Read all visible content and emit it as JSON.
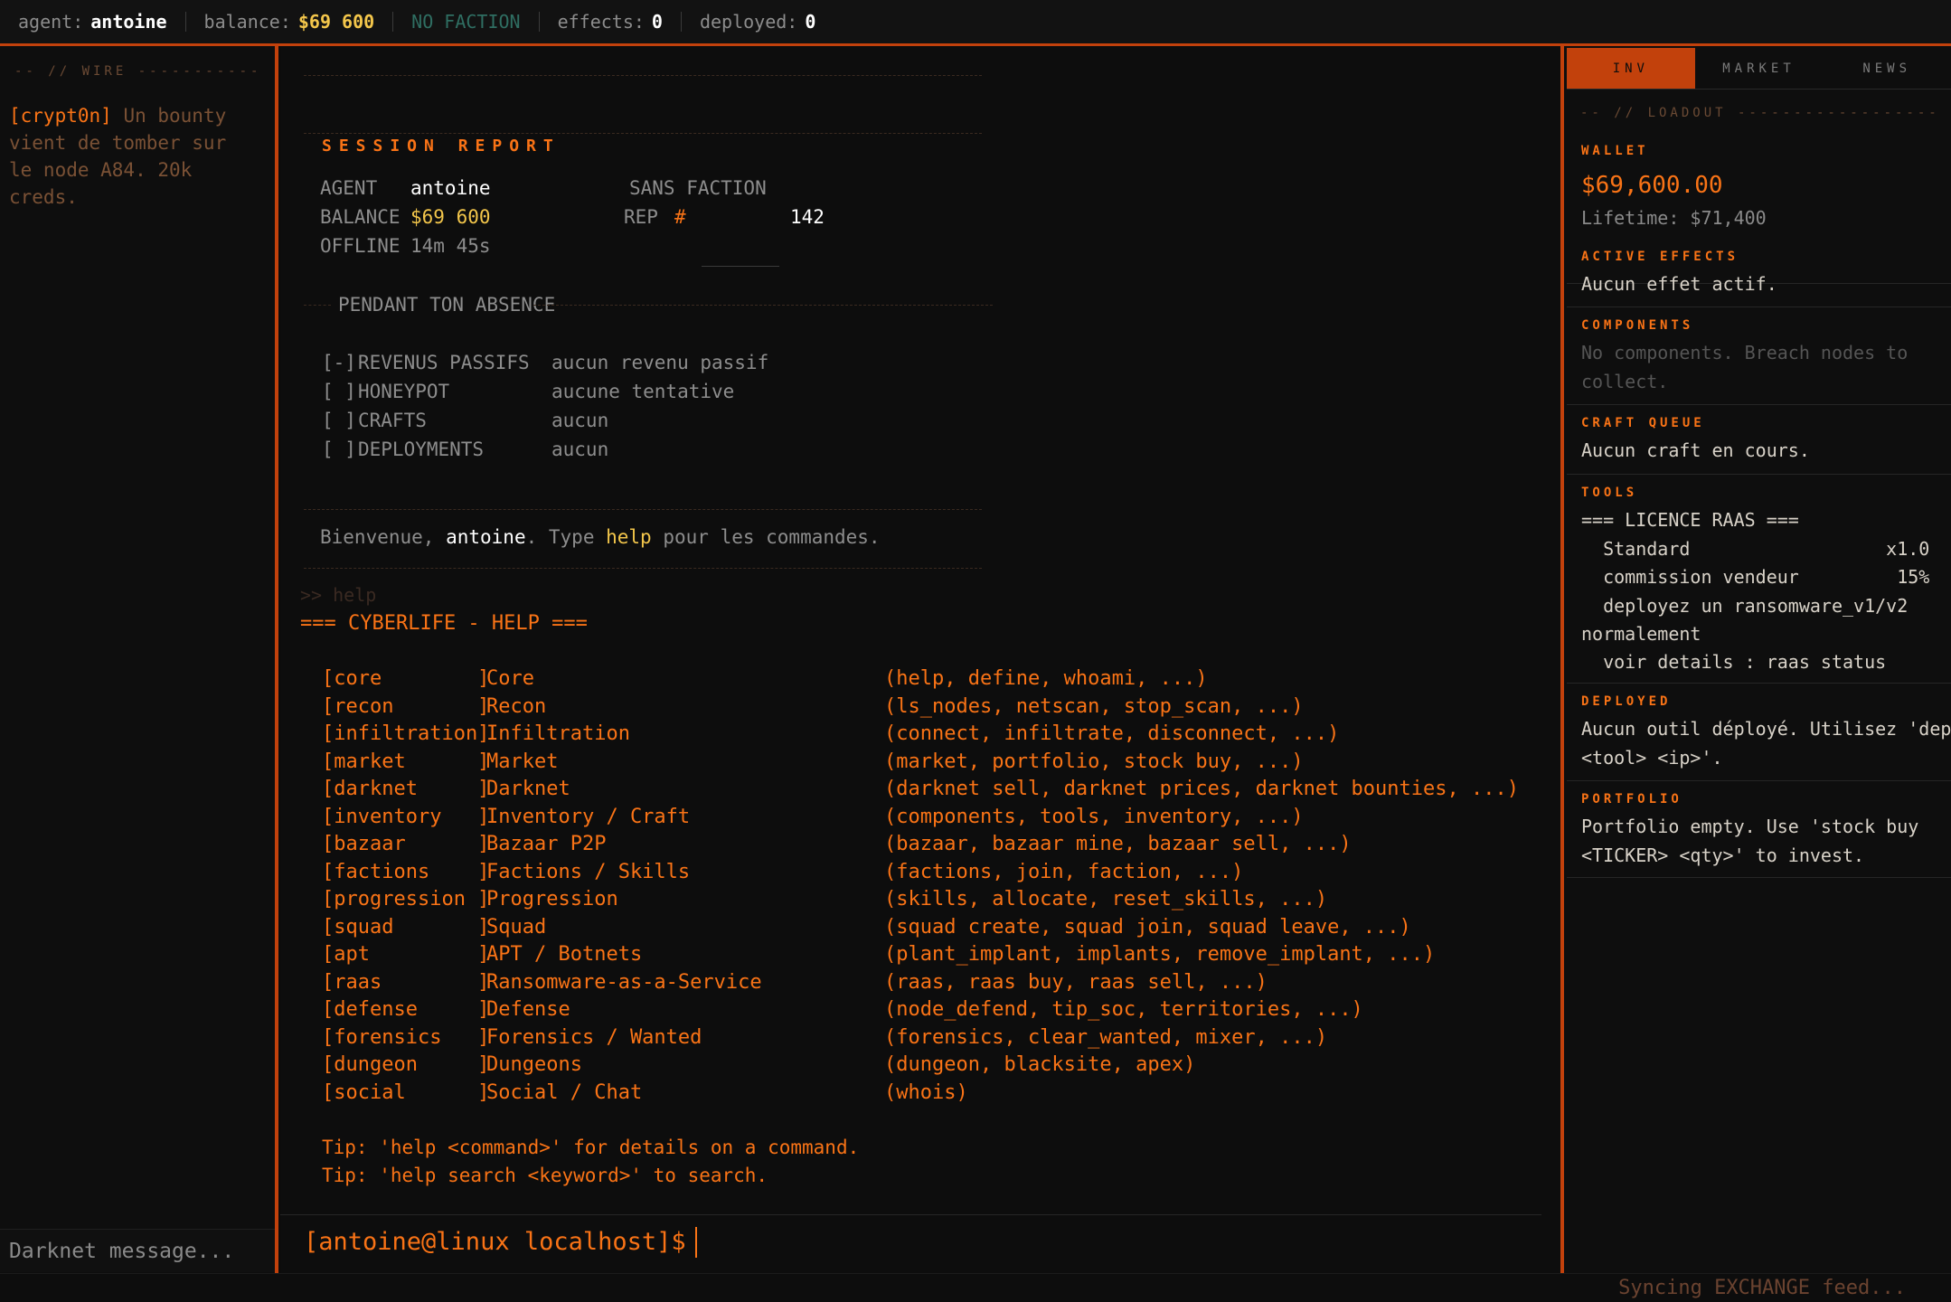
{
  "topbar": {
    "agent_label": "agent:",
    "agent_value": "antoine",
    "balance_label": "balance:",
    "balance_value": "$69 600",
    "faction": "NO FACTION",
    "effects_label": "effects:",
    "effects_value": "0",
    "deployed_label": "deployed:",
    "deployed_value": "0"
  },
  "wire": {
    "header": "-- // WIRE -------------",
    "message_tag": "[crypt0n]",
    "message_text": "Un bounty vient de tomber sur le node A84. 20k creds.",
    "input_placeholder": "Darknet message..."
  },
  "session_report": {
    "title": "SESSION REPORT",
    "agent_label": "AGENT",
    "agent_value": "antoine",
    "balance_label": "BALANCE",
    "balance_value": "$69 600",
    "offline_label": "OFFLINE",
    "offline_value": "14m 45s",
    "faction_label": "SANS FACTION",
    "rep_label": "REP",
    "rep_marker": "#",
    "rep_value": "142",
    "absence_header": "PENDANT TON ABSENCE",
    "absence_items": [
      {
        "check": "[-]",
        "label": "REVENUS PASSIFS",
        "value": "aucun revenu passif"
      },
      {
        "check": "[ ]",
        "label": "HONEYPOT",
        "value": "aucune tentative"
      },
      {
        "check": "[ ]",
        "label": "CRAFTS",
        "value": "aucun"
      },
      {
        "check": "[ ]",
        "label": "DEPLOYMENTS",
        "value": "aucun"
      }
    ],
    "welcome_prefix": "Bienvenue,",
    "welcome_name": "antoine",
    "welcome_mid": ". Type",
    "welcome_cmd": "help",
    "welcome_suffix": "pour les commandes."
  },
  "terminal": {
    "echo": ">> help",
    "help_title": "=== CYBERLIFE - HELP ===",
    "help_rows": [
      {
        "key": "[core        ]",
        "name": "Core",
        "cmds": "(help, define, whoami, ...)"
      },
      {
        "key": "[recon       ]",
        "name": "Recon",
        "cmds": "(ls_nodes, netscan, stop_scan, ...)"
      },
      {
        "key": "[infiltration]",
        "name": "Infiltration",
        "cmds": "(connect, infiltrate, disconnect, ...)"
      },
      {
        "key": "[market      ]",
        "name": "Market",
        "cmds": "(market, portfolio, stock buy, ...)"
      },
      {
        "key": "[darknet     ]",
        "name": "Darknet",
        "cmds": "(darknet sell, darknet prices, darknet bounties, ...)"
      },
      {
        "key": "[inventory   ]",
        "name": "Inventory / Craft",
        "cmds": "(components, tools, inventory, ...)"
      },
      {
        "key": "[bazaar      ]",
        "name": "Bazaar P2P",
        "cmds": "(bazaar, bazaar mine, bazaar sell, ...)"
      },
      {
        "key": "[factions    ]",
        "name": "Factions / Skills",
        "cmds": "(factions, join, faction, ...)"
      },
      {
        "key": "[progression ]",
        "name": "Progression",
        "cmds": "(skills, allocate, reset_skills, ...)"
      },
      {
        "key": "[squad       ]",
        "name": "Squad",
        "cmds": "(squad create, squad join, squad leave, ...)"
      },
      {
        "key": "[apt         ]",
        "name": "APT / Botnets",
        "cmds": "(plant_implant, implants, remove_implant, ...)"
      },
      {
        "key": "[raas        ]",
        "name": "Ransomware-as-a-Service",
        "cmds": "(raas, raas buy, raas sell, ...)"
      },
      {
        "key": "[defense     ]",
        "name": "Defense",
        "cmds": "(node_defend, tip_soc, territories, ...)"
      },
      {
        "key": "[forensics   ]",
        "name": "Forensics / Wanted",
        "cmds": "(forensics, clear_wanted, mixer, ...)"
      },
      {
        "key": "[dungeon     ]",
        "name": "Dungeons",
        "cmds": "(dungeon, blacksite, apex)"
      },
      {
        "key": "[social      ]",
        "name": "Social / Chat",
        "cmds": "(whois)"
      }
    ],
    "tip1": "Tip: 'help <command>' for details on a command.",
    "tip2": "Tip: 'help search <keyword>' to search.",
    "prompt": "[antoine@linux localhost]$"
  },
  "right_panel": {
    "tabs": [
      "INV",
      "MARKET",
      "NEWS"
    ],
    "active_tab": "INV",
    "loadout_header": "-- // LOADOUT ----------------------",
    "wallet_title": "WALLET",
    "wallet_value": "$69,600.00",
    "wallet_lifetime": "Lifetime: $71,400",
    "effects_title": "ACTIVE EFFECTS",
    "effects_text": "Aucun effet actif.",
    "components_title": "COMPONENTS",
    "components_text": "No components. Breach nodes to\ncollect.",
    "craft_title": "CRAFT QUEUE",
    "craft_text": "Aucun craft en cours.",
    "tools_title": "TOOLS",
    "tools_lines": [
      "=== LICENCE RAAS ===",
      "  Standard                  x1.0",
      "  commission vendeur         15%",
      "  deployez un ransomware_v1/v2",
      "normalement",
      "  voir details : raas status"
    ],
    "deployed_title": "DEPLOYED",
    "deployed_text": "Aucun outil déployé. Utilisez 'deploy\n<tool> <ip>'.",
    "portfolio_title": "PORTFOLIO",
    "portfolio_text": "Portfolio empty. Use 'stock buy\n<TICKER> <qty>' to invest."
  },
  "status": {
    "text": "Syncing EXCHANGE feed..."
  },
  "colors": {
    "accent": "#f97316",
    "accent_dark": "#c2410c",
    "money": "#f3c64b",
    "faction": "#2f6e62",
    "background": "#0b0b0b"
  }
}
